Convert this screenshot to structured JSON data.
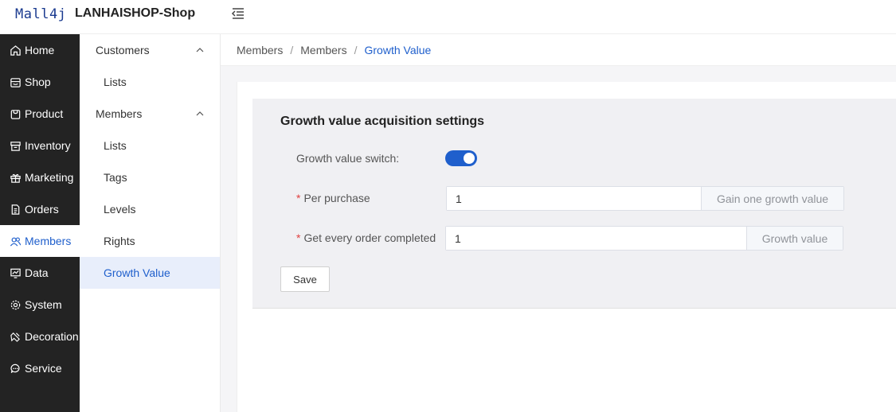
{
  "header": {
    "logo_text": "Mall4j",
    "brand": "LANHAISHOP-Shop"
  },
  "sidebar": {
    "items": [
      {
        "label": "Home",
        "icon": "home-icon"
      },
      {
        "label": "Shop",
        "icon": "shop-icon"
      },
      {
        "label": "Product",
        "icon": "product-icon"
      },
      {
        "label": "Inventory",
        "icon": "inventory-icon"
      },
      {
        "label": "Marketing",
        "icon": "gift-icon"
      },
      {
        "label": "Orders",
        "icon": "document-icon"
      },
      {
        "label": "Members",
        "icon": "members-icon"
      },
      {
        "label": "Data",
        "icon": "chart-icon"
      },
      {
        "label": "System",
        "icon": "gear-icon"
      },
      {
        "label": "Decoration",
        "icon": "brush-icon"
      },
      {
        "label": "Service",
        "icon": "chat-icon"
      }
    ],
    "active_index": 6
  },
  "submenu": {
    "groups": [
      {
        "label": "Customers",
        "items": [
          "Lists"
        ]
      },
      {
        "label": "Members",
        "items": [
          "Lists",
          "Tags",
          "Levels",
          "Rights",
          "Growth Value"
        ]
      }
    ],
    "active_item": "Growth Value"
  },
  "breadcrumb": {
    "items": [
      "Members",
      "Members",
      "Growth Value"
    ],
    "separator": "/"
  },
  "settings": {
    "title": "Growth value acquisition settings",
    "switch_label": "Growth value switch:",
    "switch_on": true,
    "per_purchase": {
      "label": "Per purchase",
      "value": "1",
      "append": "Gain one growth value"
    },
    "per_order": {
      "label": "Get every order completed",
      "value": "1",
      "append": "Growth value"
    },
    "save_label": "Save"
  },
  "colors": {
    "accent": "#1f5fcc",
    "sidebar_bg": "#232323",
    "required": "#e04040"
  }
}
